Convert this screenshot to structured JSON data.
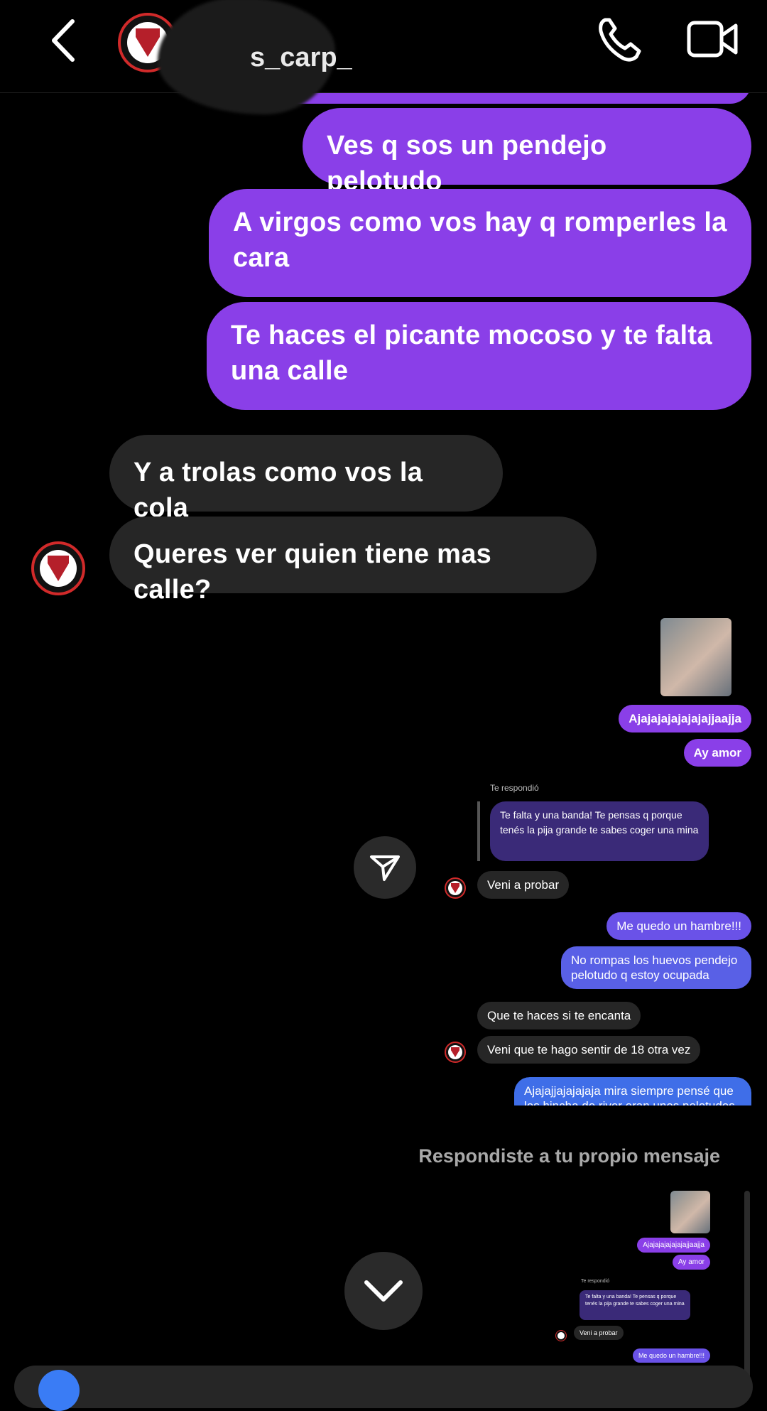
{
  "header": {
    "username_visible": "s_carp_",
    "icons": {
      "back": "chevron-left-icon",
      "call": "phone-icon",
      "video": "video-camera-icon"
    }
  },
  "messages_top": [
    {
      "side": "out",
      "text": "Ves q sos un pendejo pelotudo"
    },
    {
      "side": "out",
      "text": "A virgos como vos hay q romperles la cara"
    },
    {
      "side": "out",
      "text": "Te haces el picante  mocoso y te falta una calle"
    },
    {
      "side": "in",
      "text": "Y a trolas como vos la cola"
    },
    {
      "side": "in",
      "text": "Queres ver quien tiene mas calle?"
    }
  ],
  "shared_screenshot": {
    "messages": [
      {
        "side": "out",
        "text": "Ajajajajajajajajjaajja"
      },
      {
        "side": "out",
        "text": "Ay amor"
      },
      {
        "side": "reply_label",
        "text": "Te respondió"
      },
      {
        "side": "quoted",
        "text": "Te falta y una banda! Te pensas q porque tenés la pija grande te sabes coger una mina"
      },
      {
        "side": "in",
        "text": "Veni a probar"
      },
      {
        "side": "out",
        "text": "Me quedo un hambre!!!"
      },
      {
        "side": "out",
        "text": "No rompas los huevos pendejo pelotudo q estoy ocupada"
      },
      {
        "side": "in",
        "text": "Que te haces si te encanta"
      },
      {
        "side": "in",
        "text": "Veni que te hago sentir de 18 otra vez"
      },
      {
        "side": "out",
        "text": "Ajajajjajajajaja  mira siempre pensé que los hincha de river eran unos pelotudos"
      }
    ]
  },
  "reply_notice": "Respondiste a tu propio mensaje",
  "quoted_preview": {
    "messages": [
      {
        "text": "Ajajajajajajajajjaajja"
      },
      {
        "text": "Ay amor"
      },
      {
        "text": "Te respondió"
      },
      {
        "text": "Te falta y una banda! Te pensas q porque tenés la pija grande te sabes coger una mina"
      },
      {
        "text": "Veni a probar"
      },
      {
        "text": "Me quedo un hambre!!!"
      }
    ]
  },
  "colors": {
    "outgoing": "#8a3fe8",
    "outgoing_blue": "#4a5fe6",
    "incoming": "#262626",
    "avatar_ring": "#d12a2a"
  }
}
